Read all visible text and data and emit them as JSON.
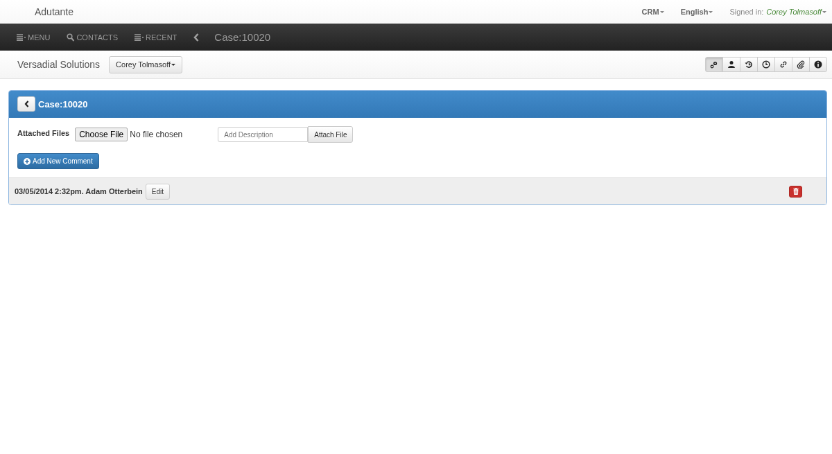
{
  "brand": "Adutante",
  "top_menu": {
    "crm": "CRM",
    "language": "English",
    "signed_in_label": "Signed in:",
    "user": "Corey Tolmasoff"
  },
  "nav": [
    {
      "kind": "list",
      "label": "MENU"
    },
    {
      "kind": "search",
      "label": "CONTACTS"
    },
    {
      "kind": "list",
      "label": "RECENT"
    }
  ],
  "nav_title": "Case:10020",
  "subbar": {
    "company": "Versadial Solutions",
    "user_dropdown": "Corey Tolmasoff",
    "tools": [
      {
        "kind": "gears",
        "selected": true
      },
      {
        "kind": "user",
        "selected": false
      },
      {
        "kind": "history",
        "selected": false
      },
      {
        "kind": "clock",
        "selected": false
      },
      {
        "kind": "link",
        "selected": false
      },
      {
        "kind": "paperclip",
        "selected": false
      },
      {
        "kind": "info",
        "selected": false
      }
    ]
  },
  "panel": {
    "title": "Case:10020",
    "attached_label": "Attached Files",
    "choose_file": "Choose File",
    "no_file": "No file chosen",
    "description_placeholder": "Add Description",
    "attach_button": "Attach File",
    "add_comment": "Add New Comment",
    "comments": [
      {
        "meta": "03/05/2014 2:32pm. Adam Otterbein",
        "edit": "Edit"
      }
    ]
  }
}
